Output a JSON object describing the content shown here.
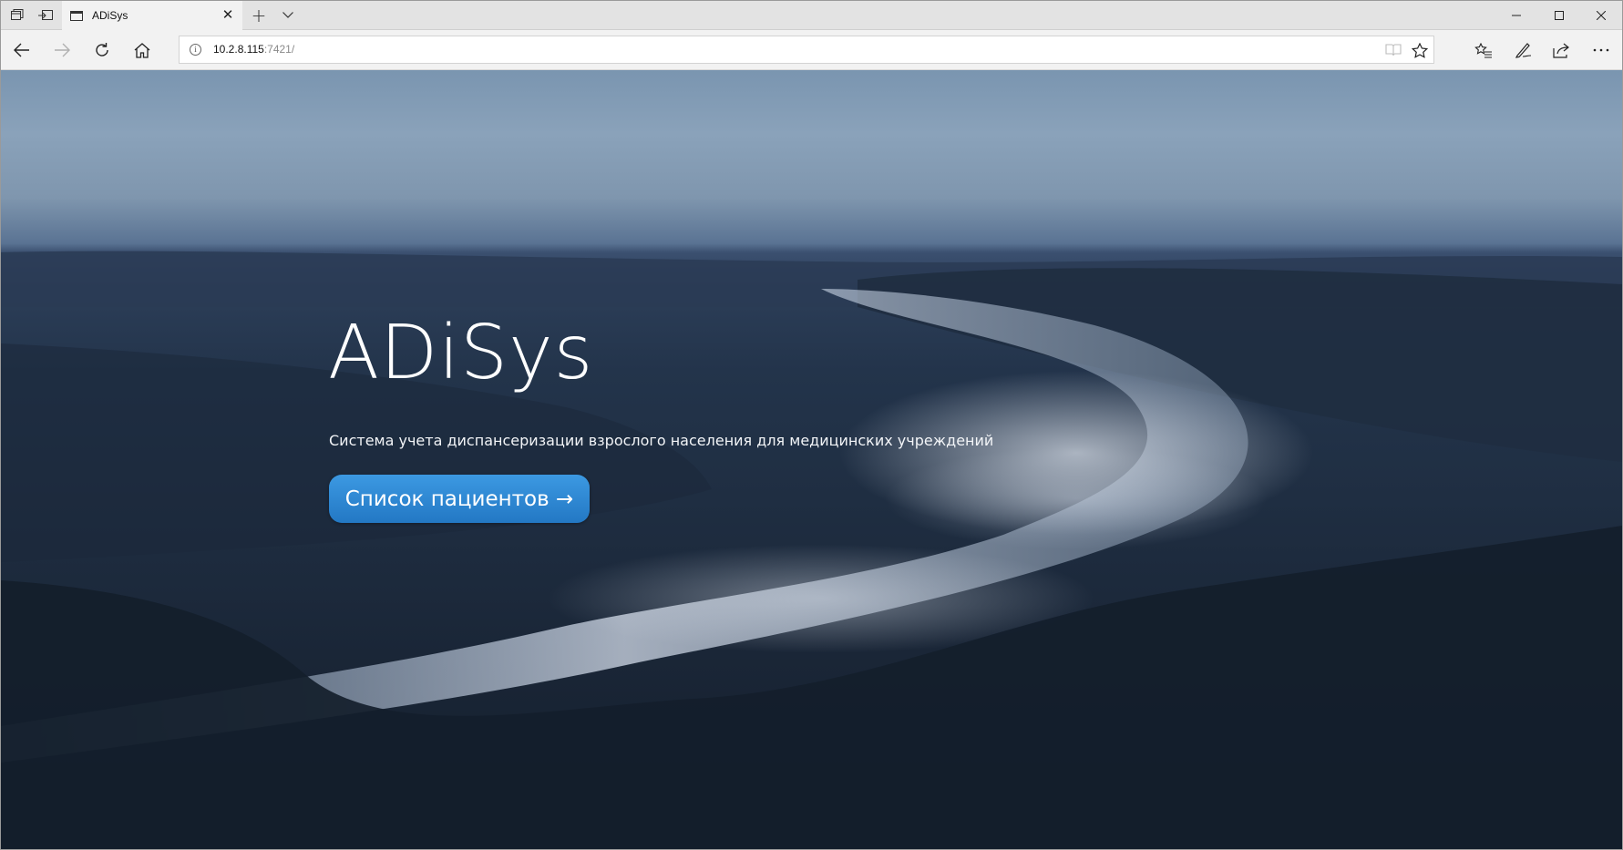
{
  "browser": {
    "tab_title": "ADiSys",
    "new_tab_label": "+",
    "tab_list_label": "⌄",
    "url_host": "10.2.8.115",
    "url_rest": ":7421/",
    "icons": {
      "set_aside_tabs": "tabs-aside-icon",
      "show_aside_tabs": "tabs-restore-icon",
      "tab_favicon": "page-icon",
      "tab_close": "close-icon",
      "new_tab": "plus-icon",
      "tab_list": "chevron-down-icon",
      "minimize": "minimize-icon",
      "maximize": "maximize-icon",
      "close_window": "close-icon",
      "back": "back-arrow-icon",
      "forward": "forward-arrow-icon",
      "refresh": "refresh-icon",
      "home": "home-icon",
      "site_info": "info-icon",
      "reading_view": "book-icon",
      "favorite": "star-icon",
      "favorites_hub": "favorites-list-icon",
      "web_note": "pen-icon",
      "share": "share-icon",
      "more": "more-dots-icon"
    },
    "forward_enabled": false
  },
  "hero": {
    "title": "ADiSys",
    "subtitle": "Система учета диспансеризации взрослого населения для медицинских учреждений",
    "button_label": "Список пациентов →",
    "button_color": "#2a86d3"
  }
}
